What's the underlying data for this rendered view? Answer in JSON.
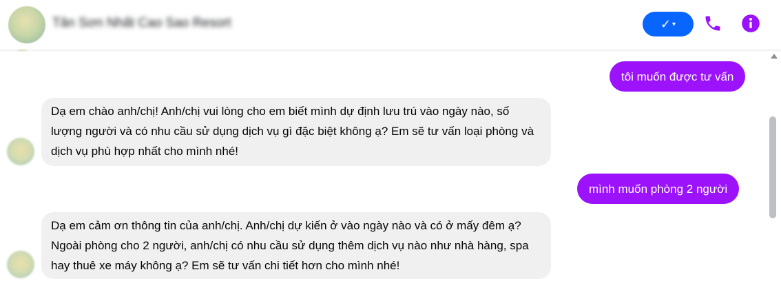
{
  "header": {
    "contact_name": "Tân Sơn Nhất Cao Sao Resort",
    "status_button": {
      "check": "✓",
      "caret": "▾",
      "color": "#0866ff"
    },
    "icons": [
      "phone-icon",
      "info-icon"
    ],
    "accent_color": "#9b12fb"
  },
  "conversation": {
    "messages": [
      {
        "direction": "outgoing",
        "text": "tôi muốn được tư vấn"
      },
      {
        "direction": "incoming",
        "text": "Dạ em chào anh/chị! Anh/chị vui lòng cho em biết mình dự định lưu trú vào ngày nào, số lượng người và có nhu cầu sử dụng dịch vụ gì đặc biệt không ạ? Em sẽ tư vấn loại phòng và dịch vụ phù hợp nhất cho mình nhé!"
      },
      {
        "direction": "outgoing",
        "text": "mình muốn phòng 2 người"
      },
      {
        "direction": "incoming",
        "text": "Dạ em cảm ơn thông tin của anh/chị. Anh/chị dự kiến ở vào ngày nào và có ở mấy đêm ạ? Ngoài phòng cho 2 người, anh/chị có nhu cầu sử dụng thêm dịch vụ nào như nhà hàng, spa hay thuê xe máy không ạ? Em sẽ tư vấn chi tiết hơn cho mình nhé!"
      }
    ]
  }
}
